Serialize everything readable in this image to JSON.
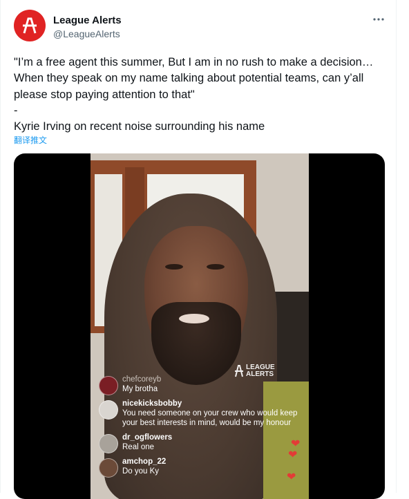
{
  "account": {
    "name": "League Alerts",
    "handle": "@LeagueAlerts",
    "avatar_icon": "league-alerts-logo",
    "avatar_color": "#e02323"
  },
  "tweet": {
    "text": "\"I’m a free agent this summer, But I am in no rush to make a decision… When they speak on my name talking about potential teams, can y’all please stop paying attention to that\"\n-\nKyrie Irving on recent noise surrounding his name",
    "translate_label": "翻译推文"
  },
  "media": {
    "watermark_line1": "LEAGUE",
    "watermark_line2": "ALERTS",
    "comments": [
      {
        "user": "chefcoreyb",
        "text": "My brotha"
      },
      {
        "user": "nicekicksbobby",
        "text": "You need someone on your crew who would keep your best interests in mind, would be my honour"
      },
      {
        "user": "dr_ogflowers",
        "text": "Real one"
      },
      {
        "user": "amchop_22",
        "text": "Do you Ky"
      }
    ],
    "heart_icon": "heart-icon"
  }
}
